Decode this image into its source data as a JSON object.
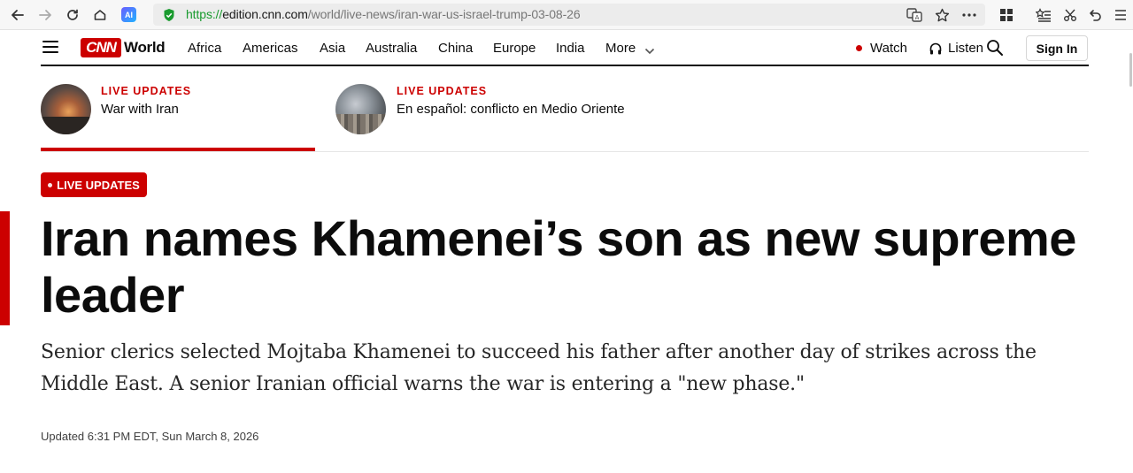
{
  "browser": {
    "url_scheme": "https://",
    "url_host": "edition.cnn.com",
    "url_path": "/world/live-news/iran-war-us-israel-trump-03-08-26",
    "ai_label": "AI"
  },
  "nav": {
    "logo": "CNN",
    "edition": "World",
    "links": [
      "Africa",
      "Americas",
      "Asia",
      "Australia",
      "China",
      "Europe",
      "India",
      "More"
    ],
    "watch": "Watch",
    "listen": "Listen",
    "sign_in": "Sign In"
  },
  "cards": [
    {
      "kicker": "LIVE UPDATES",
      "title": "War with Iran"
    },
    {
      "kicker": "LIVE UPDATES",
      "title": "En español: conflicto en Medio Oriente"
    }
  ],
  "article": {
    "badge": "LIVE UPDATES",
    "headline": "Iran names Khamenei’s son as new supreme leader",
    "dek": "Senior clerics selected Mojtaba Khamenei to succeed his father after another day of strikes across the Middle East. A senior Iranian official warns the war is entering a \"new phase.\"",
    "updated": "Updated 6:31 PM EDT, Sun March 8, 2026"
  },
  "colors": {
    "brand_red": "#cc0000",
    "text": "#0c0c0c"
  }
}
